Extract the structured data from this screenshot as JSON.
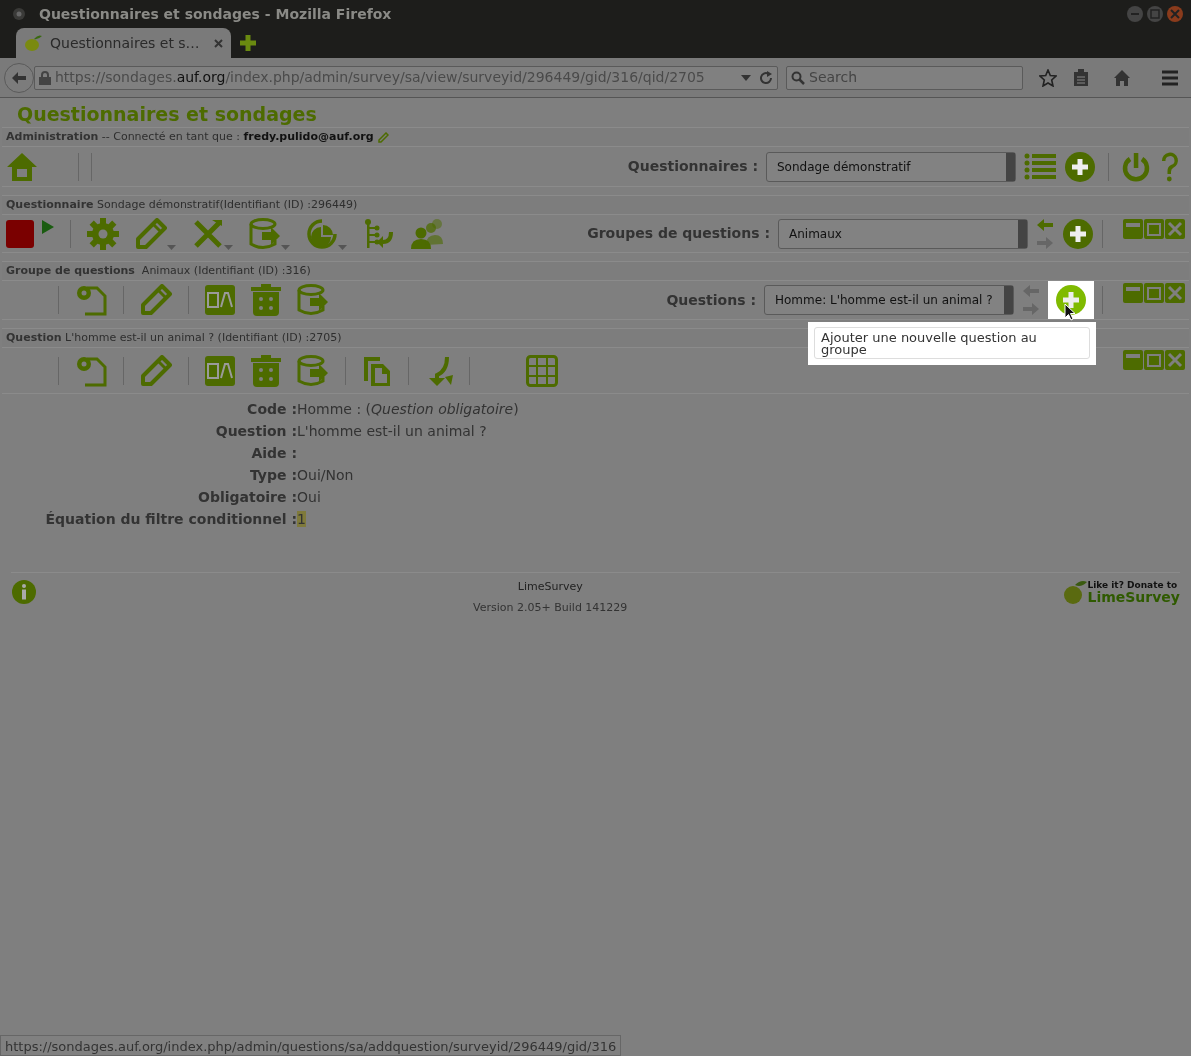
{
  "window": {
    "title": "Questionnaires et sondages - Mozilla Firefox"
  },
  "browser": {
    "tabs": [
      {
        "label": "Questionnaires et s…",
        "selected": true
      }
    ],
    "url": {
      "prefix": "https://sondages.",
      "domain": "auf.org",
      "path": "/index.php/admin/survey/sa/view/surveyid/296449/gid/316/qid/2705"
    },
    "search": {
      "placeholder": "Search"
    }
  },
  "app_title": "Questionnaires et sondages",
  "admin_bar": {
    "label": "Administration",
    "text": "-- Connecté en tant que :",
    "user": "fredy.pulido@auf.org",
    "selector_label": "Questionnaires :",
    "selector_value": "Sondage démonstratif"
  },
  "sections": [
    {
      "kind": "survey",
      "heading": "Questionnaire",
      "text": "Sondage démonstratif(Identifiant (ID) :296449)",
      "selector_label": "Groupes de questions :",
      "selector_value": "Animaux"
    },
    {
      "kind": "group",
      "heading": "Groupe de questions",
      "text": "Animaux (Identifiant (ID) :316)",
      "selector_label": "Questions :",
      "selector_value": "Homme: L'homme est-il un animal ?"
    },
    {
      "kind": "question",
      "heading": "Question",
      "text": "L'homme est-il un animal ? (Identifiant (ID) :2705)"
    }
  ],
  "tooltip": "Ajouter une nouvelle question au groupe",
  "details": [
    {
      "label": "Code :",
      "value": "Homme : (*Question obligatoire*)",
      "kind": "text"
    },
    {
      "label": "Question :",
      "value": "L'homme est-il un animal ?",
      "kind": "text"
    },
    {
      "label": "Aide :",
      "kind": "text"
    },
    {
      "label": "Type :",
      "value": "Oui/Non",
      "kind": "text"
    },
    {
      "label": "Obligatoire :",
      "value": "Oui",
      "kind": "text"
    },
    {
      "label": "Équation du filtre conditionnel :",
      "value": "1",
      "kind": "expression"
    }
  ],
  "footer": {
    "name": "LimeSurvey",
    "version": "Version 2.05+ Build 141229",
    "donate_line": "Like it? Donate to",
    "donate_brand": "LimeSurvey"
  },
  "status_url": "https://sondages.auf.org/index.php/admin/questions/sa/addquestion/surveyid/296449/gid/316"
}
